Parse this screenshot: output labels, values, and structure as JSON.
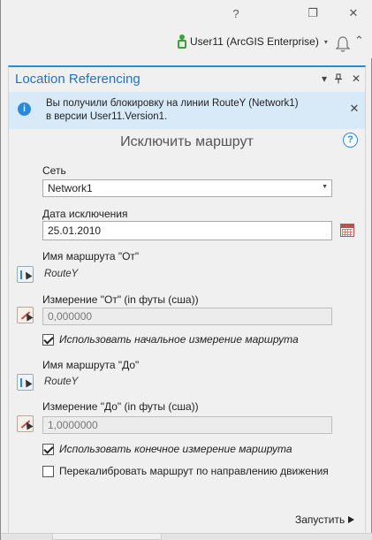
{
  "window": {
    "help_glyph": "?",
    "restore_glyph": "❐",
    "close_glyph": "✕"
  },
  "user": {
    "name": "User11 (ArcGIS Enterprise)",
    "caret": "▾",
    "up_glyph": "⌃"
  },
  "panel": {
    "title": "Location Referencing",
    "menu_glyph": "▾",
    "pin_glyph": "📌",
    "close_glyph": "✕"
  },
  "info": {
    "icon_glyph": "i",
    "line1": "Вы получили блокировку на линии RouteY (Network1)",
    "line2": "в версии User11.Version1.",
    "close_glyph": "✕"
  },
  "tool": {
    "title": "Исключить маршрут",
    "help_glyph": "?"
  },
  "network": {
    "label": "Сеть",
    "value": "Network1",
    "arrow": "▼"
  },
  "retire_date": {
    "label": "Дата исключения",
    "value": "25.01.2010"
  },
  "from_route": {
    "label": "Имя маршрута \"От\"",
    "value": "RouteY"
  },
  "from_measure": {
    "label": "Измерение \"От\" (in футы (сша))",
    "value": "0,000000"
  },
  "use_start": {
    "label": "Использовать начальное измерение маршрута",
    "checked": true
  },
  "to_route": {
    "label": "Имя маршрута \"До\"",
    "value": "RouteY"
  },
  "to_measure": {
    "label": "Измерение \"До\" (in футы (сша))",
    "value": "1,0000000"
  },
  "use_end": {
    "label": "Использовать конечное измерение маршрута",
    "checked": true
  },
  "recalibrate": {
    "label": "Перекалибровать маршрут по направлению движения",
    "checked": false
  },
  "run": {
    "label": "Запустить"
  },
  "colors": {
    "accent": "#2b8ad8",
    "title_blue": "#1f73c4",
    "info_bg": "#d8e9f7",
    "user_green": "#3c9e3c"
  }
}
